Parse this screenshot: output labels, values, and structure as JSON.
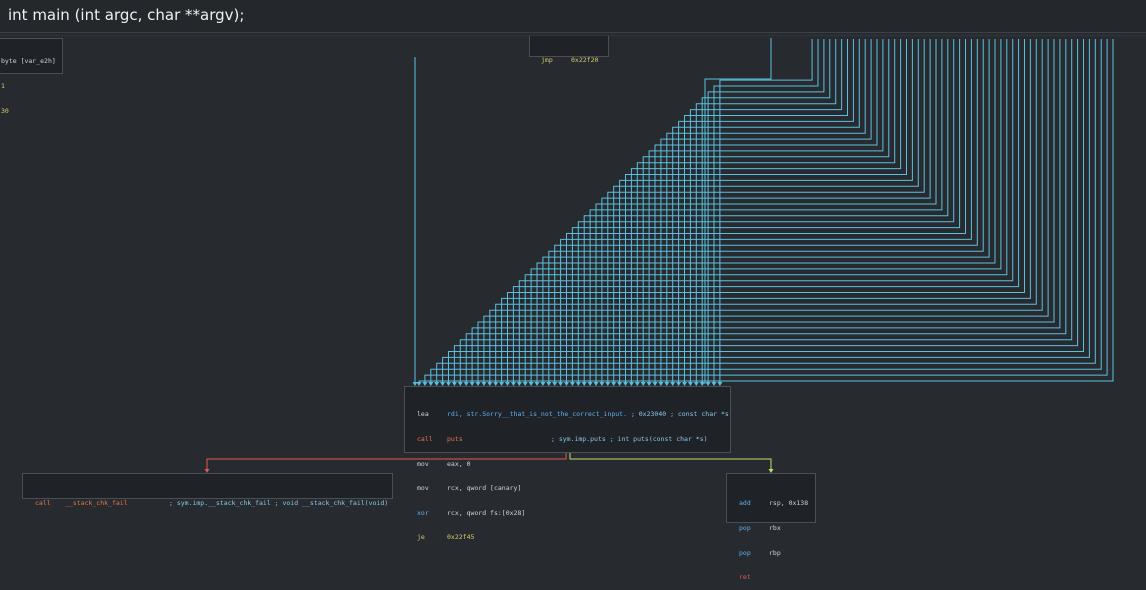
{
  "function_signature": "int main (int argc, char **argv);",
  "blocks": {
    "top_left": {
      "lines": [
        "byte [var_e2h]",
        "1",
        "30"
      ]
    },
    "top_center": {
      "mnemonic": "jmp",
      "operand": "0x22f20"
    },
    "main": {
      "rows": [
        {
          "mnemonic": "lea",
          "operand": "rdi, str.Sorry__that_is_not_the_correct_input.",
          "comment": "; 0x23040 ; const char *s"
        },
        {
          "mnemonic": "call",
          "operand": "puts",
          "comment": "; sym.imp.puts ; int puts(const char *s)"
        },
        {
          "mnemonic": "mov",
          "operand": "eax, 0",
          "comment": ""
        },
        {
          "mnemonic": "mov",
          "operand": "rcx, qword [canary]",
          "comment": ""
        },
        {
          "mnemonic": "xor",
          "operand": "rcx, qword fs:[0x28]",
          "comment": ""
        },
        {
          "mnemonic": "je",
          "operand": "0x22f45",
          "comment": ""
        }
      ]
    },
    "fail": {
      "mnemonic": "call",
      "operand": "__stack_chk_fail",
      "comment": "; sym.imp.__stack_chk_fail ; void __stack_chk_fail(void)"
    },
    "ret": {
      "rows": [
        {
          "mnemonic": "add",
          "operand": "rsp, 0x138"
        },
        {
          "mnemonic": "pop",
          "operand": "rbx"
        },
        {
          "mnemonic": "pop",
          "operand": "rbp"
        },
        {
          "mnemonic": "ret",
          "operand": ""
        }
      ]
    }
  },
  "colors": {
    "background": "#272b30",
    "edge_unconditional": "#5bc0de",
    "edge_false": "#e05858",
    "edge_true": "#b8e06a"
  }
}
